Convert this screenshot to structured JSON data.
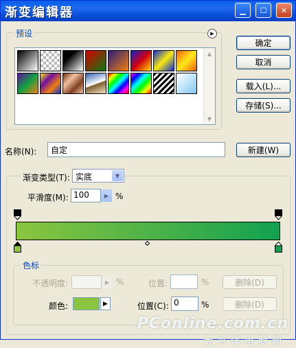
{
  "window": {
    "title": "渐变编辑器"
  },
  "presets": {
    "legend": "预设",
    "swatches": [
      {
        "name": "foreground-to-background",
        "bg": "linear-gradient(135deg,#000,#fff)"
      },
      {
        "name": "foreground-to-transparent",
        "bg": "repeating-conic-gradient(#bbb 0 25%,#fff 0 50%) 0 0/8px 8px"
      },
      {
        "name": "black-white",
        "bg": "linear-gradient(135deg,#000 30%,#fff)"
      },
      {
        "name": "red-green",
        "bg": "linear-gradient(135deg,#D80000,#0A7A10)"
      },
      {
        "name": "violet-orange",
        "bg": "linear-gradient(135deg,#2A1C7A,#F08010)"
      },
      {
        "name": "blue-red-yellow",
        "bg": "linear-gradient(135deg,#1020D0,#D00010,#FFE000)"
      },
      {
        "name": "blue-yellow-blue",
        "bg": "linear-gradient(135deg,#1030D0,#F8E810,#1030D0)"
      },
      {
        "name": "orange-yellow-orange",
        "bg": "linear-gradient(135deg,#F06010,#FFE818,#F06010)"
      },
      {
        "name": "violet-green-orange",
        "bg": "linear-gradient(135deg,#6010A0,#10A040,#F08010)"
      },
      {
        "name": "yellow-violet-orange-blue",
        "bg": "linear-gradient(135deg,#F8E810,#7010A0,#F08010,#1030D0)"
      },
      {
        "name": "copper",
        "bg": "linear-gradient(135deg,#703010,#F0C0A0,#804020,#F0C0A0)"
      },
      {
        "name": "chrome",
        "bg": "linear-gradient(160deg,#3060B0,#fff 50%,#806030 55%,#F0E0C0)"
      },
      {
        "name": "spectrum",
        "bg": "linear-gradient(135deg,#F00,#FF0,#0F0,#0FF,#00F,#F0F,#F00)"
      },
      {
        "name": "transparent-rainbow",
        "bg": "linear-gradient(135deg,#F0F,#00F,#0FF,#0F0,#FF0,#F00)"
      },
      {
        "name": "transparent-stripes",
        "bg": "repeating-linear-gradient(135deg,#000 0 3px,#fff 3px 6px)"
      },
      {
        "name": "light-blue",
        "bg": "linear-gradient(135deg,#fff,#80C8F0)"
      }
    ]
  },
  "buttons": {
    "ok": "确定",
    "cancel": "取消",
    "load": "载入(L)...",
    "save": "存储(S)...",
    "new": "新建(W)",
    "delete_opacity": "删除(D)",
    "delete_color": "删除(D)"
  },
  "name_field": {
    "label": "名称(N):",
    "value": "自定"
  },
  "gradient": {
    "type_label": "渐变类型(T):",
    "type_value": "实底",
    "smoothness_label": "平滑度(M):",
    "smoothness_value": "100",
    "smoothness_unit": "%",
    "start_color": "#8BC53F",
    "end_color": "#12A150",
    "midpoint": 0.5
  },
  "color_stops": {
    "legend": "色标",
    "opacity_label": "不透明度:",
    "opacity_unit": "%",
    "opacity_location_label": "位置:",
    "opacity_location_unit": "%",
    "color_label": "颜色:",
    "color_value": "#8BC53F",
    "location_label": "位置(C):",
    "location_value": "0",
    "location_unit": "%"
  },
  "watermark": {
    "brand": "PConline.com.cn",
    "sub": "太平洋电脑网"
  }
}
